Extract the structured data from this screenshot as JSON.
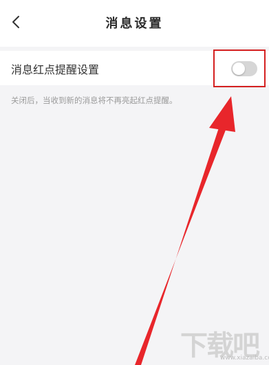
{
  "header": {
    "title": "消息设置",
    "back_icon": "chevron-left-icon"
  },
  "setting": {
    "label": "消息红点提醒设置",
    "enabled": false,
    "description": "关闭后，当收到新的消息将不再亮起红点提醒。"
  },
  "annotation": {
    "color": "#d41f1f"
  },
  "watermark": {
    "text": "下载吧",
    "url": "www.xiazaiba.com"
  }
}
